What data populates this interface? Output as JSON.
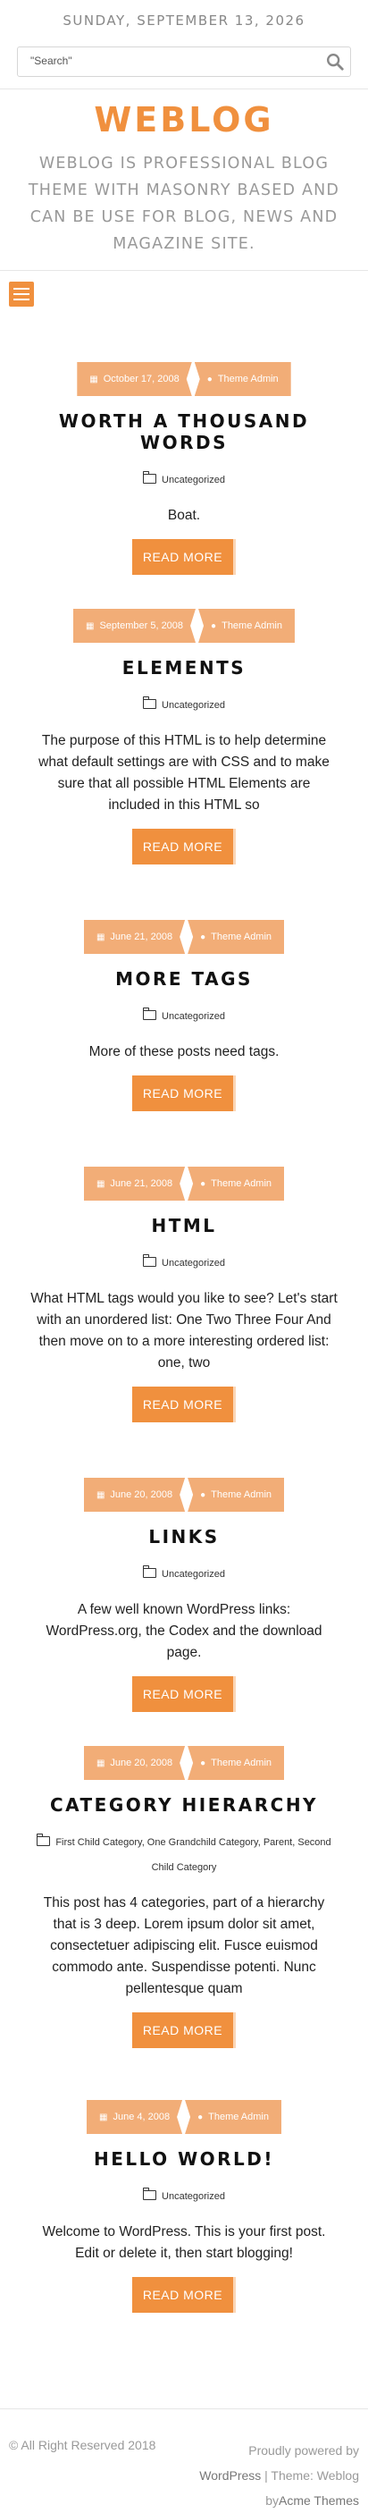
{
  "header": {
    "date": "SUNDAY, SEPTEMBER 13, 2026",
    "search_value": "\"Search\"",
    "search_icon": "magnifier-icon",
    "site_title": "WEBLOG",
    "site_description": "WEBLOG IS PROFESSIONAL BLOG THEME WITH MASONRY BASED AND CAN BE USE FOR BLOG, NEWS AND MAGAZINE SITE.",
    "menu_icon": "hamburger-icon"
  },
  "colors": {
    "accent": "#f0903e",
    "meta_bg": "#f2ad77",
    "muted": "#999999"
  },
  "posts": [
    {
      "date": "October 17, 2008",
      "author": "Theme Admin",
      "title": "WORTH A THOUSAND WORDS",
      "categories": "Uncategorized",
      "excerpt": "Boat.",
      "read_more": "READ MORE"
    },
    {
      "date": "September 5, 2008",
      "author": "Theme Admin",
      "title": "ELEMENTS",
      "categories": "Uncategorized",
      "excerpt": "The purpose of this HTML is to help determine what default settings are with CSS and to make sure that all possible HTML Elements are included in this HTML so",
      "read_more": "READ MORE"
    },
    {
      "date": "June 21, 2008",
      "author": "Theme Admin",
      "title": "MORE TAGS",
      "categories": "Uncategorized",
      "excerpt": "More of these posts need tags.",
      "read_more": "READ MORE"
    },
    {
      "date": "June 21, 2008",
      "author": "Theme Admin",
      "title": "HTML",
      "categories": "Uncategorized",
      "excerpt": "What HTML tags would you like to see? Let's start with an unordered list: One Two Three Four And then move on to a more interesting ordered list: one, two",
      "read_more": "READ MORE"
    },
    {
      "date": "June 20, 2008",
      "author": "Theme Admin",
      "title": "LINKS",
      "categories": "Uncategorized",
      "excerpt": "A few well known WordPress links: WordPress.org, the Codex and the download page.",
      "read_more": "READ MORE"
    },
    {
      "date": "June 20, 2008",
      "author": "Theme Admin",
      "title": "CATEGORY HIERARCHY",
      "categories": "First Child Category, One Grandchild Category, Parent, Second Child Category",
      "excerpt": "This post has 4 categories, part of a hierarchy that is 3 deep. Lorem ipsum dolor sit amet, consectetuer adipiscing elit. Fusce euismod commodo ante. Suspendisse potenti. Nunc pellentesque quam",
      "read_more": "READ MORE"
    },
    {
      "date": "June 4, 2008",
      "author": "Theme Admin",
      "title": "HELLO WORLD!",
      "categories": "Uncategorized",
      "excerpt": "Welcome to WordPress. This is your first post. Edit or delete it, then start blogging!",
      "read_more": "READ MORE"
    }
  ],
  "footer": {
    "copyright": "© All Right Reserved 2018",
    "proudly": "Proudly powered by",
    "wordpress": "WordPress",
    "separator": " | Theme: Weblog",
    "by": "by",
    "acme": "Acme Themes"
  }
}
